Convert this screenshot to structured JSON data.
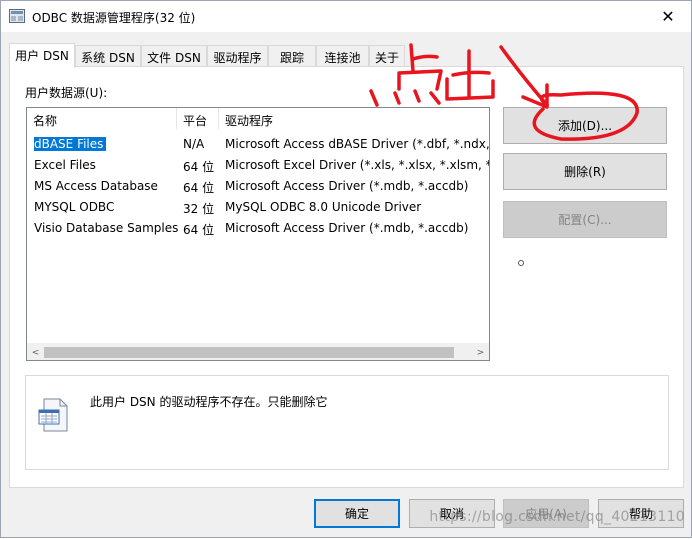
{
  "window": {
    "title": "ODBC 数据源管理程序(32 位)",
    "close_glyph": "✕"
  },
  "tabs": [
    {
      "label": "用户 DSN",
      "active": true
    },
    {
      "label": "系统 DSN",
      "active": false
    },
    {
      "label": "文件 DSN",
      "active": false
    },
    {
      "label": "驱动程序",
      "active": false
    },
    {
      "label": "跟踪",
      "active": false
    },
    {
      "label": "连接池",
      "active": false
    },
    {
      "label": "关于",
      "active": false
    }
  ],
  "panel": {
    "section_label": "用户数据源(U):",
    "columns": [
      "名称",
      "平台",
      "驱动程序"
    ],
    "rows": [
      {
        "name": "dBASE Files",
        "platform": "N/A",
        "driver": "Microsoft Access dBASE Driver (*.dbf, *.ndx, *",
        "selected": true
      },
      {
        "name": "Excel Files",
        "platform": "64 位",
        "driver": "Microsoft Excel Driver (*.xls, *.xlsx, *.xlsm, *.xls",
        "selected": false
      },
      {
        "name": "MS Access Database",
        "platform": "64 位",
        "driver": "Microsoft Access Driver (*.mdb, *.accdb)",
        "selected": false
      },
      {
        "name": "MYSQL ODBC",
        "platform": "32 位",
        "driver": "MySQL ODBC 8.0 Unicode Driver",
        "selected": false
      },
      {
        "name": "Visio Database Samples",
        "platform": "64 位",
        "driver": "Microsoft Access Driver (*.mdb, *.accdb)",
        "selected": false
      }
    ],
    "scroll_left": "<",
    "scroll_right": ">"
  },
  "side_buttons": {
    "add": "添加(D)...",
    "remove": "删除(R)",
    "configure": "配置(C)..."
  },
  "message": {
    "text": "此用户 DSN 的驱动程序不存在。只能删除它"
  },
  "bottom_buttons": {
    "ok": "确定",
    "cancel": "取消",
    "apply": "应用(A)",
    "help": "帮助"
  },
  "watermark": "https://blog.csdn.net/qq_40213110",
  "annotation": {
    "text": "点击",
    "color": "#e8141e"
  }
}
